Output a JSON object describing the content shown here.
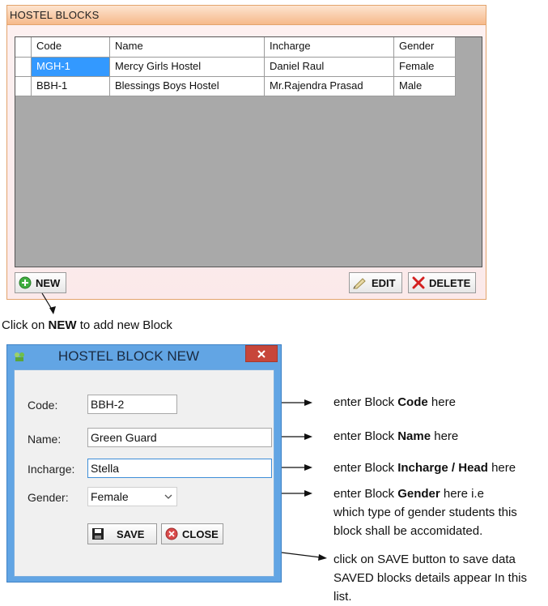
{
  "blocks_window": {
    "title": "HOSTEL BLOCKS",
    "columns": [
      "Code",
      "Name",
      "Incharge",
      "Gender"
    ],
    "rows": [
      {
        "code": "MGH-1",
        "name": "Mercy Girls Hostel",
        "incharge": "Daniel Raul",
        "gender": "Female",
        "selected": true
      },
      {
        "code": "BBH-1",
        "name": "Blessings Boys Hostel",
        "incharge": "Mr.Rajendra Prasad",
        "gender": "Male",
        "selected": false
      }
    ],
    "buttons": {
      "new": "NEW",
      "edit": "EDIT",
      "delete": "DELETE"
    }
  },
  "instruction_new": {
    "prefix": "Click on ",
    "bold": "NEW",
    "suffix": " to add new Block"
  },
  "dialog": {
    "title": "HOSTEL BLOCK NEW",
    "fields": {
      "code": {
        "label": "Code:",
        "value": "BBH-2"
      },
      "name": {
        "label": "Name:",
        "value": "Green Guard"
      },
      "incharge": {
        "label": "Incharge:",
        "value": "Stella"
      },
      "gender": {
        "label": "Gender:",
        "value": "Female"
      }
    },
    "buttons": {
      "save": "SAVE",
      "close": "CLOSE"
    }
  },
  "annotations": {
    "code": {
      "prefix": "enter  Block  ",
      "bold": "Code",
      "suffix": " here"
    },
    "name": {
      "prefix": "enter  Block  ",
      "bold": "Name",
      "suffix": " here"
    },
    "incharge": {
      "prefix": "enter  Block  ",
      "bold": "Incharge /  Head",
      "suffix": " here"
    },
    "gender": {
      "prefix": "enter  Block  ",
      "bold": "Gender",
      "suffix": "  here i.e",
      "line2": "which type of gender students this",
      "line3": "block shall be accomidated."
    },
    "save": {
      "line1": "click on SAVE button to save data",
      "line2": "SAVED blocks details appear In this list."
    }
  },
  "colors": {
    "selection": "#3399ff",
    "dialog_frame": "#62a5e4",
    "window_title": "#f6b98a"
  }
}
